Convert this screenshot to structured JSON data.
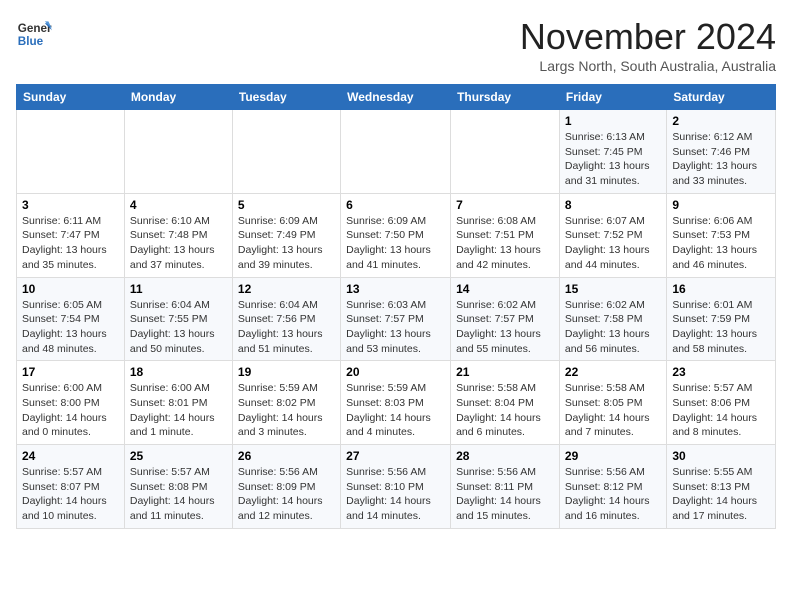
{
  "header": {
    "logo_general": "General",
    "logo_blue": "Blue",
    "month_title": "November 2024",
    "location": "Largs North, South Australia, Australia"
  },
  "days_of_week": [
    "Sunday",
    "Monday",
    "Tuesday",
    "Wednesday",
    "Thursday",
    "Friday",
    "Saturday"
  ],
  "weeks": [
    [
      {
        "day": "",
        "info": ""
      },
      {
        "day": "",
        "info": ""
      },
      {
        "day": "",
        "info": ""
      },
      {
        "day": "",
        "info": ""
      },
      {
        "day": "",
        "info": ""
      },
      {
        "day": "1",
        "info": "Sunrise: 6:13 AM\nSunset: 7:45 PM\nDaylight: 13 hours and 31 minutes."
      },
      {
        "day": "2",
        "info": "Sunrise: 6:12 AM\nSunset: 7:46 PM\nDaylight: 13 hours and 33 minutes."
      }
    ],
    [
      {
        "day": "3",
        "info": "Sunrise: 6:11 AM\nSunset: 7:47 PM\nDaylight: 13 hours and 35 minutes."
      },
      {
        "day": "4",
        "info": "Sunrise: 6:10 AM\nSunset: 7:48 PM\nDaylight: 13 hours and 37 minutes."
      },
      {
        "day": "5",
        "info": "Sunrise: 6:09 AM\nSunset: 7:49 PM\nDaylight: 13 hours and 39 minutes."
      },
      {
        "day": "6",
        "info": "Sunrise: 6:09 AM\nSunset: 7:50 PM\nDaylight: 13 hours and 41 minutes."
      },
      {
        "day": "7",
        "info": "Sunrise: 6:08 AM\nSunset: 7:51 PM\nDaylight: 13 hours and 42 minutes."
      },
      {
        "day": "8",
        "info": "Sunrise: 6:07 AM\nSunset: 7:52 PM\nDaylight: 13 hours and 44 minutes."
      },
      {
        "day": "9",
        "info": "Sunrise: 6:06 AM\nSunset: 7:53 PM\nDaylight: 13 hours and 46 minutes."
      }
    ],
    [
      {
        "day": "10",
        "info": "Sunrise: 6:05 AM\nSunset: 7:54 PM\nDaylight: 13 hours and 48 minutes."
      },
      {
        "day": "11",
        "info": "Sunrise: 6:04 AM\nSunset: 7:55 PM\nDaylight: 13 hours and 50 minutes."
      },
      {
        "day": "12",
        "info": "Sunrise: 6:04 AM\nSunset: 7:56 PM\nDaylight: 13 hours and 51 minutes."
      },
      {
        "day": "13",
        "info": "Sunrise: 6:03 AM\nSunset: 7:57 PM\nDaylight: 13 hours and 53 minutes."
      },
      {
        "day": "14",
        "info": "Sunrise: 6:02 AM\nSunset: 7:57 PM\nDaylight: 13 hours and 55 minutes."
      },
      {
        "day": "15",
        "info": "Sunrise: 6:02 AM\nSunset: 7:58 PM\nDaylight: 13 hours and 56 minutes."
      },
      {
        "day": "16",
        "info": "Sunrise: 6:01 AM\nSunset: 7:59 PM\nDaylight: 13 hours and 58 minutes."
      }
    ],
    [
      {
        "day": "17",
        "info": "Sunrise: 6:00 AM\nSunset: 8:00 PM\nDaylight: 14 hours and 0 minutes."
      },
      {
        "day": "18",
        "info": "Sunrise: 6:00 AM\nSunset: 8:01 PM\nDaylight: 14 hours and 1 minute."
      },
      {
        "day": "19",
        "info": "Sunrise: 5:59 AM\nSunset: 8:02 PM\nDaylight: 14 hours and 3 minutes."
      },
      {
        "day": "20",
        "info": "Sunrise: 5:59 AM\nSunset: 8:03 PM\nDaylight: 14 hours and 4 minutes."
      },
      {
        "day": "21",
        "info": "Sunrise: 5:58 AM\nSunset: 8:04 PM\nDaylight: 14 hours and 6 minutes."
      },
      {
        "day": "22",
        "info": "Sunrise: 5:58 AM\nSunset: 8:05 PM\nDaylight: 14 hours and 7 minutes."
      },
      {
        "day": "23",
        "info": "Sunrise: 5:57 AM\nSunset: 8:06 PM\nDaylight: 14 hours and 8 minutes."
      }
    ],
    [
      {
        "day": "24",
        "info": "Sunrise: 5:57 AM\nSunset: 8:07 PM\nDaylight: 14 hours and 10 minutes."
      },
      {
        "day": "25",
        "info": "Sunrise: 5:57 AM\nSunset: 8:08 PM\nDaylight: 14 hours and 11 minutes."
      },
      {
        "day": "26",
        "info": "Sunrise: 5:56 AM\nSunset: 8:09 PM\nDaylight: 14 hours and 12 minutes."
      },
      {
        "day": "27",
        "info": "Sunrise: 5:56 AM\nSunset: 8:10 PM\nDaylight: 14 hours and 14 minutes."
      },
      {
        "day": "28",
        "info": "Sunrise: 5:56 AM\nSunset: 8:11 PM\nDaylight: 14 hours and 15 minutes."
      },
      {
        "day": "29",
        "info": "Sunrise: 5:56 AM\nSunset: 8:12 PM\nDaylight: 14 hours and 16 minutes."
      },
      {
        "day": "30",
        "info": "Sunrise: 5:55 AM\nSunset: 8:13 PM\nDaylight: 14 hours and 17 minutes."
      }
    ]
  ]
}
